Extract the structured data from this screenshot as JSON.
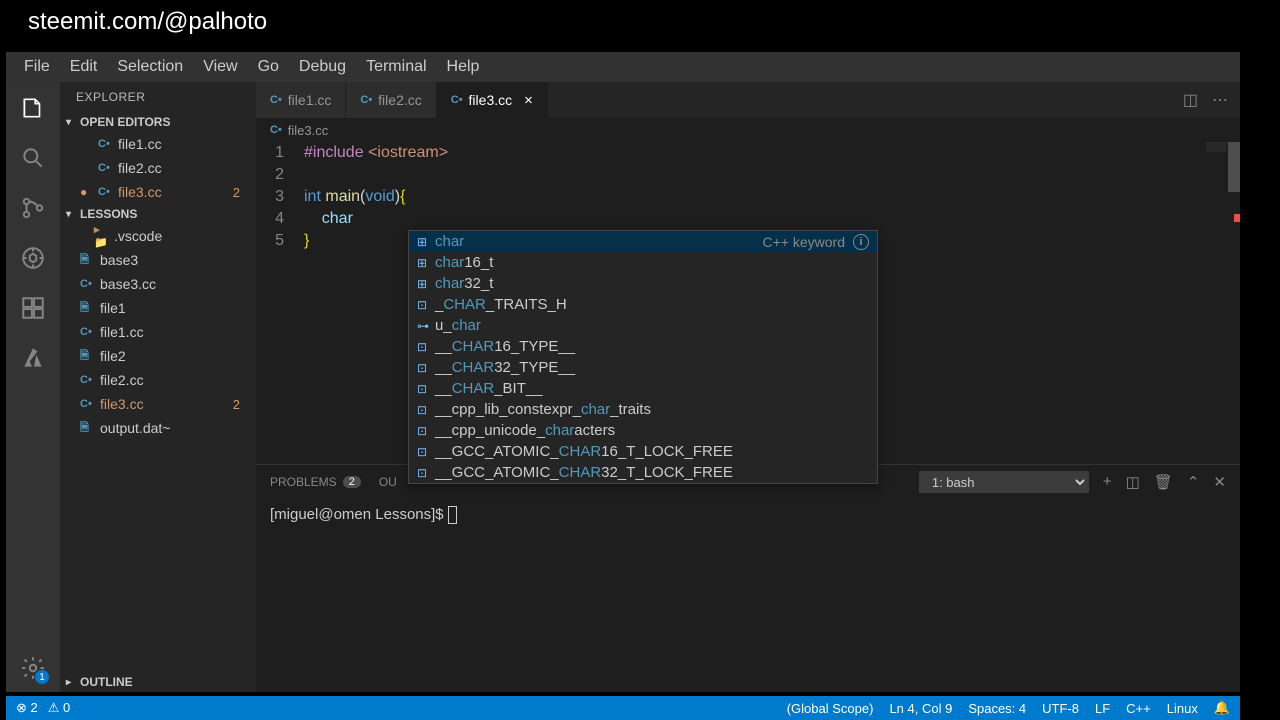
{
  "watermark": "steemit.com/@palhoto",
  "menu": [
    "File",
    "Edit",
    "Selection",
    "View",
    "Go",
    "Debug",
    "Terminal",
    "Help"
  ],
  "sidebar": {
    "title": "EXPLORER",
    "open_editors_label": "OPEN EDITORS",
    "open_editors": [
      {
        "name": "file1.cc",
        "kind": "cpp"
      },
      {
        "name": "file2.cc",
        "kind": "cpp"
      },
      {
        "name": "file3.cc",
        "kind": "cpp",
        "modified": true,
        "badge": "2",
        "unsaved": true
      }
    ],
    "workspace_label": "LESSONS",
    "files": [
      {
        "name": ".vscode",
        "kind": "folder",
        "indent": true
      },
      {
        "name": "base3",
        "kind": "file"
      },
      {
        "name": "base3.cc",
        "kind": "cpp"
      },
      {
        "name": "file1",
        "kind": "file"
      },
      {
        "name": "file1.cc",
        "kind": "cpp"
      },
      {
        "name": "file2",
        "kind": "file"
      },
      {
        "name": "file2.cc",
        "kind": "cpp"
      },
      {
        "name": "file3.cc",
        "kind": "cpp",
        "modified": true,
        "badge": "2"
      },
      {
        "name": "output.dat~",
        "kind": "file"
      }
    ],
    "outline_label": "OUTLINE"
  },
  "tabs": [
    {
      "name": "file1.cc"
    },
    {
      "name": "file2.cc"
    },
    {
      "name": "file3.cc",
      "active": true,
      "close": true
    }
  ],
  "breadcrumb": {
    "icon": "C",
    "name": "file3.cc"
  },
  "code": {
    "lines": [
      {
        "n": 1,
        "segs": [
          {
            "t": "#include",
            "c": "k-pre"
          },
          {
            "t": " ",
            "c": ""
          },
          {
            "t": "<iostream>",
            "c": "k-str"
          }
        ]
      },
      {
        "n": 2,
        "segs": []
      },
      {
        "n": 3,
        "segs": [
          {
            "t": "int",
            "c": "k-type"
          },
          {
            "t": " ",
            "c": ""
          },
          {
            "t": "main",
            "c": "k-func"
          },
          {
            "t": "(",
            "c": "k-paren"
          },
          {
            "t": "void",
            "c": "k-type"
          },
          {
            "t": ")",
            "c": "k-paren"
          },
          {
            "t": "{",
            "c": "k-brace"
          }
        ]
      },
      {
        "n": 4,
        "segs": [
          {
            "t": "    ",
            "c": ""
          },
          {
            "t": "char",
            "c": "k-var"
          }
        ]
      },
      {
        "n": 5,
        "segs": [
          {
            "t": "}",
            "c": "k-brace"
          }
        ]
      }
    ]
  },
  "autocomplete": {
    "items": [
      {
        "pre": "",
        "hl": "char",
        "post": "",
        "selected": true,
        "detail": "C++ keyword",
        "info": true,
        "icon": "kw"
      },
      {
        "pre": "",
        "hl": "char",
        "post": "16_t",
        "icon": "kw"
      },
      {
        "pre": "",
        "hl": "char",
        "post": "32_t",
        "icon": "kw"
      },
      {
        "pre": "_",
        "hl": "CHAR",
        "post": "_TRAITS_H",
        "icon": "sq"
      },
      {
        "pre": "u_",
        "hl": "char",
        "post": "",
        "icon": "oo"
      },
      {
        "pre": "__",
        "hl": "CHAR",
        "post": "16_TYPE__",
        "icon": "sq"
      },
      {
        "pre": "__",
        "hl": "CHAR",
        "post": "32_TYPE__",
        "icon": "sq"
      },
      {
        "pre": "__",
        "hl": "CHAR",
        "post": "_BIT__",
        "icon": "sq"
      },
      {
        "pre": "__cpp_lib_constexpr_",
        "hl": "char",
        "post": "_traits",
        "icon": "sq"
      },
      {
        "pre": "__cpp_unicode_",
        "hl": "char",
        "post": "acters",
        "icon": "sq"
      },
      {
        "pre": "__GCC_ATOMIC_",
        "hl": "CHAR",
        "post": "16_T_LOCK_FREE",
        "icon": "sq"
      },
      {
        "pre": "__GCC_ATOMIC_",
        "hl": "CHAR",
        "post": "32_T_LOCK_FREE",
        "icon": "sq"
      }
    ]
  },
  "panel": {
    "problems_label": "PROBLEMS",
    "problems_count": "2",
    "output_label": "OU",
    "terminal_select": "1: bash",
    "terminal_prompt": "[miguel@omen Lessons]$ "
  },
  "status": {
    "errors": "2",
    "warnings": "0",
    "scope": "(Global Scope)",
    "cursor": "Ln 4, Col 9",
    "spaces": "Spaces: 4",
    "encoding": "UTF-8",
    "eol": "LF",
    "lang": "C++",
    "os": "Linux",
    "bell": "🔔"
  }
}
